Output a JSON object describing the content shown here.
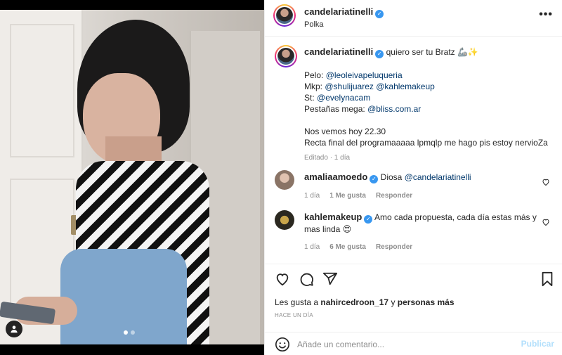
{
  "post": {
    "username": "candelariatinelli",
    "location": "Polka",
    "carousel": {
      "count": 2,
      "active": 0
    }
  },
  "caption": {
    "username": "candelariatinelli",
    "title": "quiero ser tu Bratz 🦾✨",
    "pelo_label": "Pelo:",
    "pelo_link": "@leoleivapeluqueria",
    "mkp_label": "Mkp:",
    "mkp_link1": "@shulijuarez",
    "mkp_link2": "@kahlemakeup",
    "st_label": "St:",
    "st_link": "@evelynacam",
    "pestanas_label": "Pestañas mega:",
    "pestanas_link": "@bliss.com.ar",
    "line_hoy": "Nos vemos hoy 22.30",
    "line_final": "Recta final del programaaaaa lpmqlp me hago pis estoy nervioZa",
    "meta": "Editado · 1 día"
  },
  "comments": [
    {
      "username": "amaliaamoedo",
      "text": "Diosa",
      "mention": "@candelariatinelli",
      "time": "1 día",
      "likes": "1 Me gusta",
      "reply": "Responder"
    },
    {
      "username": "kahlemakeup",
      "text": "Amo cada propuesta, cada día estas más y mas linda 😍",
      "time": "1 día",
      "likes": "6 Me gusta",
      "reply": "Responder"
    }
  ],
  "likes": {
    "prefix": "Les gusta a",
    "user": "nahircedroon_17",
    "middle": "y",
    "others": "personas más"
  },
  "timestamp": "HACE UN DÍA",
  "add_comment": {
    "placeholder": "Añade un comentario...",
    "publish": "Publicar"
  },
  "colors": {
    "link": "#00376b",
    "verified": "#3897f0",
    "publish_disabled": "#b2dffc",
    "muted": "#8e8e8e"
  },
  "icons": [
    "more-icon",
    "verified-icon",
    "heart-icon",
    "comment-icon",
    "share-icon",
    "bookmark-icon",
    "emoji-icon",
    "user-tag-icon"
  ]
}
